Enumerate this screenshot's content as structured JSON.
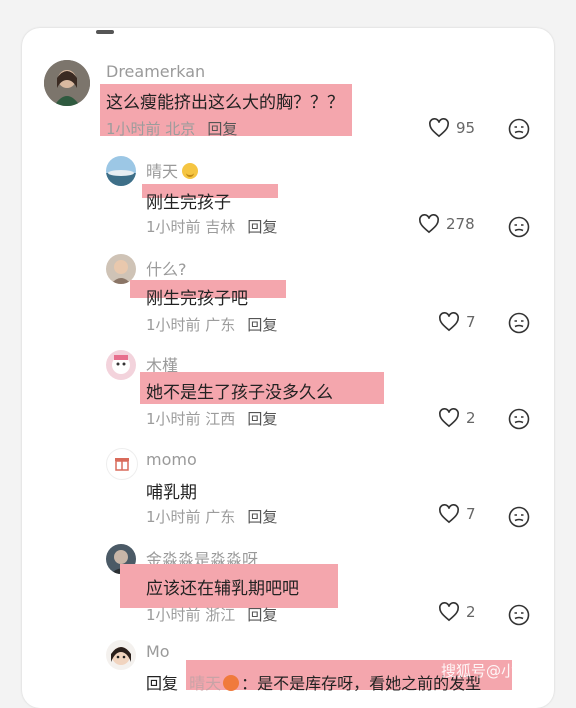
{
  "comments": [
    {
      "username": "Dreamerkan",
      "text": "这么瘦能挤出这么大的胸？？？",
      "time_loc": "1小时前 北京",
      "reply": "回复",
      "likes": "95"
    },
    {
      "username": "晴天",
      "text": "刚生完孩子",
      "time_loc": "1小时前 吉林",
      "reply": "回复",
      "likes": "278"
    },
    {
      "username": "什么?",
      "text": "刚生完孩子吧",
      "time_loc": "1小时前 广东",
      "reply": "回复",
      "likes": "7"
    },
    {
      "username": "木槿",
      "text": "她不是生了孩子没多久么",
      "time_loc": "1小时前 江西",
      "reply": "回复",
      "likes": "2"
    },
    {
      "username": "momo",
      "text": "哺乳期",
      "time_loc": "1小时前 广东",
      "reply": "回复",
      "likes": "7"
    },
    {
      "username": "金淼淼是淼淼呀",
      "text": "应该还在辅乳期吧吧",
      "time_loc": "1小时前 浙江",
      "reply": "回复",
      "likes": "2"
    },
    {
      "username": "Mo",
      "reply": "回复",
      "mention": "晴天",
      "text_tail": "：是不是库存呀，看她之前的发型"
    }
  ],
  "watermark": "搜狐号@小星月"
}
